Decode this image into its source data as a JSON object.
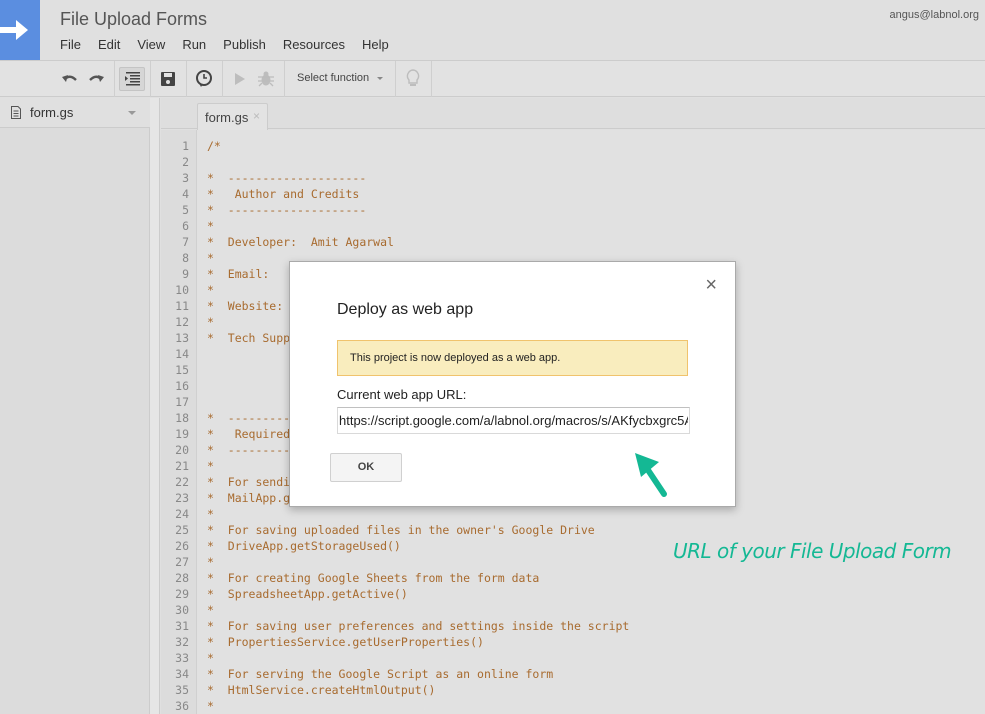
{
  "app": {
    "title": "File Upload Forms",
    "user_email": "angus@labnol.org",
    "brand_color": "#5b8ee0"
  },
  "menu": [
    "File",
    "Edit",
    "View",
    "Run",
    "Publish",
    "Resources",
    "Help"
  ],
  "toolbar": {
    "undo_icon": "undo-icon",
    "redo_icon": "redo-icon",
    "indent_icon": "indent-icon",
    "save_icon": "save-icon",
    "triggers_icon": "clock-icon",
    "run_icon": "play-icon",
    "debug_icon": "bug-icon",
    "function_select": "Select function",
    "execution_hints_icon": "lightbulb-icon"
  },
  "sidebar": {
    "files": [
      {
        "name": "form.gs"
      }
    ]
  },
  "editor": {
    "tabs": [
      {
        "label": "form.gs",
        "close": "×"
      }
    ],
    "lines": [
      {
        "n": "1",
        "text": "/*"
      },
      {
        "n": "2",
        "text": ""
      },
      {
        "n": "3",
        "text": "*  --------------------"
      },
      {
        "n": "4",
        "text": "*   Author and Credits"
      },
      {
        "n": "5",
        "text": "*  --------------------"
      },
      {
        "n": "6",
        "text": "*"
      },
      {
        "n": "7",
        "text": "*  Developer:  Amit Agarwal"
      },
      {
        "n": "8",
        "text": "*"
      },
      {
        "n": "9",
        "text": "*  Email:"
      },
      {
        "n": "10",
        "text": "*"
      },
      {
        "n": "11",
        "text": "*  Website:"
      },
      {
        "n": "12",
        "text": "*"
      },
      {
        "n": "13",
        "text": "*  Tech Supp"
      },
      {
        "n": "14",
        "text": ""
      },
      {
        "n": "15",
        "text": ""
      },
      {
        "n": "16",
        "text": ""
      },
      {
        "n": "17",
        "text": ""
      },
      {
        "n": "18",
        "text": "*  ---------"
      },
      {
        "n": "19",
        "text": "*   Required"
      },
      {
        "n": "20",
        "text": "*  ---------"
      },
      {
        "n": "21",
        "text": "*"
      },
      {
        "n": "22",
        "text": "*  For sendi"
      },
      {
        "n": "23",
        "text": "*  MailApp.g"
      },
      {
        "n": "24",
        "text": "*"
      },
      {
        "n": "25",
        "text": "*  For saving uploaded files in the owner's Google Drive"
      },
      {
        "n": "26",
        "text": "*  DriveApp.getStorageUsed()"
      },
      {
        "n": "27",
        "text": "*"
      },
      {
        "n": "28",
        "text": "*  For creating Google Sheets from the form data"
      },
      {
        "n": "29",
        "text": "*  SpreadsheetApp.getActive()"
      },
      {
        "n": "30",
        "text": "*"
      },
      {
        "n": "31",
        "text": "*  For saving user preferences and settings inside the script"
      },
      {
        "n": "32",
        "text": "*  PropertiesService.getUserProperties()"
      },
      {
        "n": "33",
        "text": "*"
      },
      {
        "n": "34",
        "text": "*  For serving the Google Script as an online form"
      },
      {
        "n": "35",
        "text": "*  HtmlService.createHtmlOutput()"
      },
      {
        "n": "36",
        "text": "*"
      }
    ],
    "code_color": "#a86b2f"
  },
  "dialog": {
    "title": "Deploy as web app",
    "close": "×",
    "notice": "This project is now deployed as a web app.",
    "url_label": "Current web app URL:",
    "url_value": "https://script.google.com/a/labnol.org/macros/s/AKfycbxgrc5A",
    "ok_label": "OK",
    "notice_bg": "#f9edbe"
  },
  "annotation": {
    "text": "URL of your File Upload Form",
    "color": "#14b894"
  }
}
